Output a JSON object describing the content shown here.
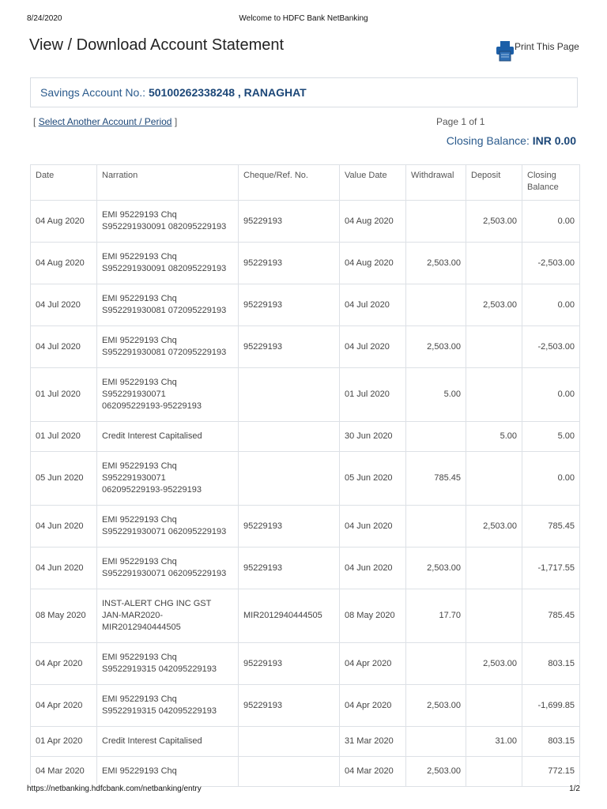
{
  "print_header": {
    "date": "8/24/2020",
    "title": "Welcome to HDFC Bank NetBanking"
  },
  "page_title": "View / Download Account Statement",
  "print_label": "Print This Page",
  "account": {
    "label": "Savings Account No.:",
    "number": "50100262338248 , RANAGHAT"
  },
  "select_link": "Select Another Account / Period",
  "bracket_open": "[",
  "bracket_close": "]",
  "pagination": {
    "text": "Page 1 of 1"
  },
  "closing_balance": {
    "label": "Closing Balance:",
    "value": "INR 0.00"
  },
  "table": {
    "headers": [
      "Date",
      "Narration",
      "Cheque/Ref. No.",
      "Value Date",
      "Withdrawal",
      "Deposit",
      "Closing\nBalance"
    ],
    "rows": [
      [
        "04 Aug 2020",
        "EMI 95229193 Chq\nS952291930091 082095229193",
        "95229193",
        "04 Aug 2020",
        "",
        "2,503.00",
        "0.00"
      ],
      [
        "04 Aug 2020",
        "EMI 95229193 Chq\nS952291930091 082095229193",
        "95229193",
        "04 Aug 2020",
        "2,503.00",
        "",
        "-2,503.00"
      ],
      [
        "04 Jul 2020",
        "EMI 95229193 Chq\nS952291930081 072095229193",
        "95229193",
        "04 Jul 2020",
        "",
        "2,503.00",
        "0.00"
      ],
      [
        "04 Jul 2020",
        "EMI 95229193 Chq\nS952291930081 072095229193",
        "95229193",
        "04 Jul 2020",
        "2,503.00",
        "",
        "-2,503.00"
      ],
      [
        "01 Jul 2020",
        "EMI 95229193 Chq\nS952291930071\n062095229193-95229193",
        "",
        "01 Jul 2020",
        "5.00",
        "",
        "0.00"
      ],
      [
        "01 Jul 2020",
        "Credit Interest Capitalised",
        "",
        "30 Jun 2020",
        "",
        "5.00",
        "5.00"
      ],
      [
        "05 Jun 2020",
        "EMI 95229193 Chq\nS952291930071\n062095229193-95229193",
        "",
        "05 Jun 2020",
        "785.45",
        "",
        "0.00"
      ],
      [
        "04 Jun 2020",
        "EMI 95229193 Chq\nS952291930071 062095229193",
        "95229193",
        "04 Jun 2020",
        "",
        "2,503.00",
        "785.45"
      ],
      [
        "04 Jun 2020",
        "EMI 95229193 Chq\nS952291930071 062095229193",
        "95229193",
        "04 Jun 2020",
        "2,503.00",
        "",
        "-1,717.55"
      ],
      [
        "08 May 2020",
        "INST-ALERT CHG INC GST\nJAN-MAR2020-\nMIR2012940444505",
        "MIR2012940444505",
        "08 May 2020",
        "17.70",
        "",
        "785.45"
      ],
      [
        "04 Apr 2020",
        "EMI 95229193 Chq\nS9522919315 042095229193",
        "95229193",
        "04 Apr 2020",
        "",
        "2,503.00",
        "803.15"
      ],
      [
        "04 Apr 2020",
        "EMI 95229193 Chq\nS9522919315 042095229193",
        "95229193",
        "04 Apr 2020",
        "2,503.00",
        "",
        "-1,699.85"
      ],
      [
        "01 Apr 2020",
        "Credit Interest Capitalised",
        "",
        "31 Mar 2020",
        "",
        "31.00",
        "803.15"
      ],
      [
        "04 Mar 2020",
        "EMI 95229193 Chq",
        "",
        "04 Mar 2020",
        "2,503.00",
        "",
        "772.15"
      ]
    ]
  },
  "print_footer": {
    "url": "https://netbanking.hdfcbank.com/netbanking/entry",
    "page": "1/2"
  },
  "colors": {
    "accent": "#1c4778",
    "border": "#dde1e6"
  }
}
